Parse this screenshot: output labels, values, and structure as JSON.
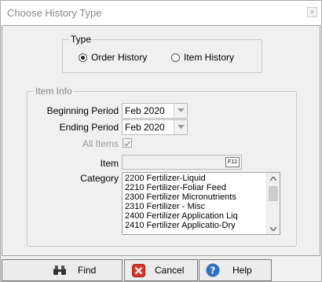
{
  "window": {
    "title": "Choose History Type",
    "close_label": "×"
  },
  "type_group": {
    "legend": "Type",
    "options": [
      {
        "label": "Order History",
        "selected": true
      },
      {
        "label": "Item History",
        "selected": false
      }
    ]
  },
  "item_info": {
    "legend": "Item Info",
    "beginning_period": {
      "label": "Beginning Period",
      "value": "Feb 2020"
    },
    "ending_period": {
      "label": "Ending Period",
      "value": "Feb 2020"
    },
    "all_items": {
      "label": "All Items",
      "checked": true
    },
    "item": {
      "label": "Item",
      "value": "",
      "lookup_key": "F12"
    },
    "category": {
      "label": "Category",
      "items": [
        "2200 Fertilizer-Liquid",
        "2210 Fertilizer-Foliar Feed",
        "2300 Fertilizer Micronutrients",
        "2310 Fertilizer - Misc",
        "2400 Fertilizer Application Liq",
        "2410 Fertilizer Applicatio-Dry"
      ]
    }
  },
  "buttons": {
    "find": "Find",
    "cancel": "Cancel",
    "help": "Help"
  },
  "colors": {
    "help_blue": "#2f6fc5",
    "cancel_red": "#d9342b"
  }
}
